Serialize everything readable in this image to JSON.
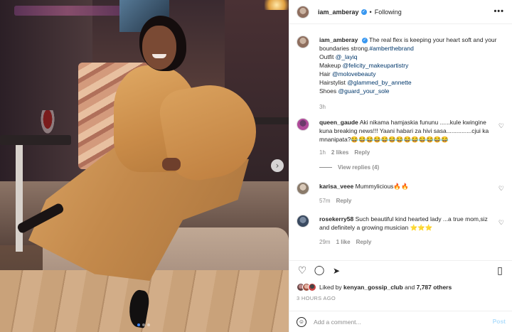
{
  "post": {
    "username": "iam_amberay",
    "follow_status": "Following",
    "more_label": "•••"
  },
  "caption": {
    "username": "iam_amberay",
    "lines": [
      "The real flex is keeping your heart soft and your boundaries strong.",
      "#amberthebrand",
      "Outfit",
      "@_layiq",
      "Makeup",
      "@felicity_makeupartistry",
      "Hair",
      "@molovebeauty",
      "Hairstylist",
      "@glammed_by_annette",
      "Shoes",
      "@guard_your_sole"
    ],
    "time": "3h"
  },
  "comments": [
    {
      "username": "queen_gaude",
      "text": "Aki nikama hamjaskia fununu ......kule kwingine kuna breaking news!!! Yaani habari za hivi sasa...............cjui ka mnanipata?😂😂😂😂😂😂😂😂😂😂😂😂😂",
      "time": "1h",
      "likes": "2 likes",
      "reply": "Reply",
      "view_replies": "View replies (4)"
    },
    {
      "username": "karisa_veee",
      "text": "Mummylicious🔥🔥",
      "time": "57m",
      "reply": "Reply"
    },
    {
      "username": "rosekerry58",
      "text": "Such beautiful kind hearted lady ...a true mom,siz and definitely a growing musician ⭐⭐⭐",
      "time": "29m",
      "likes": "1 like",
      "reply": "Reply"
    }
  ],
  "likes": {
    "prefix": "Liked by",
    "user": "kenyan_gossip_club",
    "middle": "and",
    "others": "7,787 others"
  },
  "timestamp": "3 HOURS AGO",
  "add_comment": {
    "placeholder": "Add a comment...",
    "post_label": "Post"
  },
  "icons": {
    "heart": "♡",
    "comment": "◯",
    "share": "➤",
    "save": "▯",
    "next": "›",
    "emoji": "☺"
  },
  "colors": {
    "link": "#00376b",
    "verified": "#3897f0",
    "post_button": "#b2dffc",
    "muted": "#8e8e8e",
    "carousel_active_dot": "#3b82f6"
  }
}
